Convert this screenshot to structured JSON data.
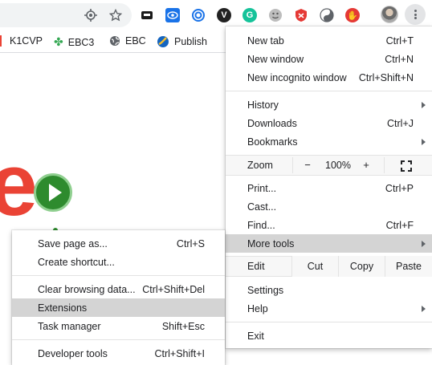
{
  "toolbar": {
    "omnibox_icons": [
      "location-target-icon",
      "bookmark-star-icon"
    ],
    "extension_icons": [
      {
        "name": "dark-extension-icon",
        "color": "#1a1a1a"
      },
      {
        "name": "eye-extension-icon",
        "color": "#1a73e8"
      },
      {
        "name": "spiral-extension-icon",
        "color": "#1a73e8"
      },
      {
        "name": "v-extension-icon",
        "color": "#222222"
      },
      {
        "name": "grammarly-extension-icon",
        "color": "#15c39a"
      },
      {
        "name": "smiley-extension-icon",
        "color": "#9aa0a6"
      },
      {
        "name": "shield-extension-icon",
        "color": "#e53935"
      },
      {
        "name": "yinyang-extension-icon",
        "color": "#5f6368"
      },
      {
        "name": "red-hand-extension-icon",
        "color": "#e53935"
      }
    ]
  },
  "bookmarks": [
    {
      "label": "K1CVP",
      "icon": "k1cvp-icon"
    },
    {
      "label": "EBC3",
      "icon": "clover-icon"
    },
    {
      "label": "EBC",
      "icon": "globe-icon"
    },
    {
      "label": "Publish",
      "icon": "publish-icon"
    }
  ],
  "main_menu": {
    "new_tab": {
      "label": "New tab",
      "shortcut": "Ctrl+T"
    },
    "new_window": {
      "label": "New window",
      "shortcut": "Ctrl+N"
    },
    "new_incognito": {
      "label": "New incognito window",
      "shortcut": "Ctrl+Shift+N"
    },
    "history": {
      "label": "History"
    },
    "downloads": {
      "label": "Downloads",
      "shortcut": "Ctrl+J"
    },
    "bookmarks": {
      "label": "Bookmarks"
    },
    "zoom": {
      "label": "Zoom",
      "minus": "−",
      "value": "100%",
      "plus": "+"
    },
    "print": {
      "label": "Print...",
      "shortcut": "Ctrl+P"
    },
    "cast": {
      "label": "Cast..."
    },
    "find": {
      "label": "Find...",
      "shortcut": "Ctrl+F"
    },
    "more_tools": {
      "label": "More tools"
    },
    "edit": {
      "label": "Edit",
      "cut": "Cut",
      "copy": "Copy",
      "paste": "Paste"
    },
    "settings": {
      "label": "Settings"
    },
    "help": {
      "label": "Help"
    },
    "exit": {
      "label": "Exit"
    }
  },
  "sub_menu": {
    "save_page": {
      "label": "Save page as...",
      "shortcut": "Ctrl+S"
    },
    "create_shortcut": {
      "label": "Create shortcut..."
    },
    "clear_browsing": {
      "label": "Clear browsing data...",
      "shortcut": "Ctrl+Shift+Del"
    },
    "extensions": {
      "label": "Extensions"
    },
    "task_manager": {
      "label": "Task manager",
      "shortcut": "Shift+Esc"
    },
    "developer_tools": {
      "label": "Developer tools",
      "shortcut": "Ctrl+Shift+I"
    }
  },
  "colors": {
    "highlight": "#d4d4d4",
    "page_red": "#ea4335",
    "play_green": "#2e8b2e"
  }
}
